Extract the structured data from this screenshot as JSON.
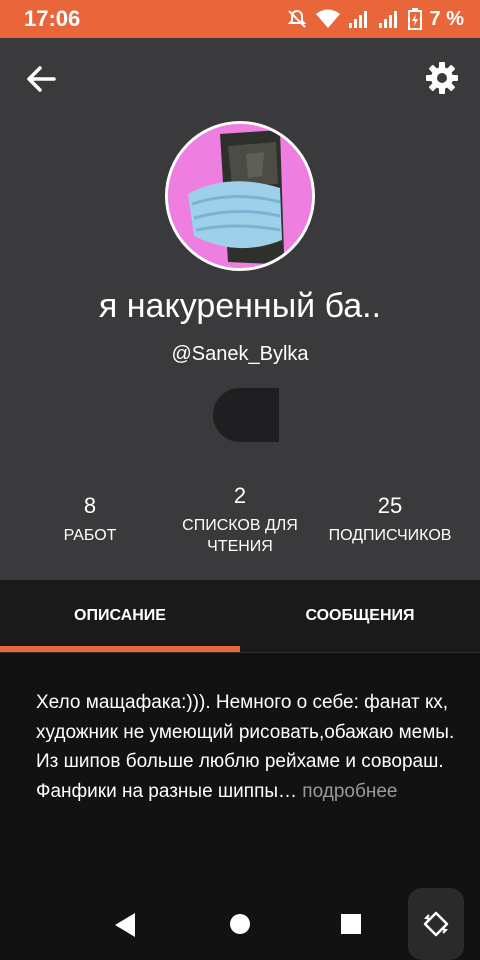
{
  "status_bar": {
    "time": "17:06",
    "battery_percent_text": "7 %",
    "icons": [
      "mute-icon",
      "wifi-icon",
      "signal-icon",
      "signal-icon",
      "battery-icon"
    ]
  },
  "header": {
    "back_icon": "arrow-left-icon",
    "settings_icon": "gear-icon"
  },
  "profile": {
    "display_name": "я накуренный ба..",
    "username": "@Sanek_Bylka",
    "avatar_background": "#ee7fe0"
  },
  "stats": [
    {
      "value": "8",
      "label": "РАБОТ"
    },
    {
      "value": "2",
      "label": "СПИСКОВ ДЛЯ ЧТЕНИЯ"
    },
    {
      "value": "25",
      "label": "ПОДПИСЧИКОВ"
    }
  ],
  "tabs": [
    {
      "label": "ОПИСАНИЕ",
      "active": true
    },
    {
      "label": "СООБЩЕНИЯ",
      "active": false
    }
  ],
  "description": {
    "text": "Хело мащафака:))). Немного о себе: фанат кх, художник не умеющий рисовать,обажаю мемы. Из шипов больше люблю рейхаме и совораш. Фанфики на разные шиппы…",
    "more_label": " подробнее"
  },
  "colors": {
    "accent": "#e8663a",
    "header_bg": "#3a3a3c",
    "page_bg": "#121212"
  },
  "nav_bar": {
    "buttons": [
      "back-triangle-icon",
      "home-circle-icon",
      "recents-square-icon",
      "rotate-icon"
    ]
  }
}
